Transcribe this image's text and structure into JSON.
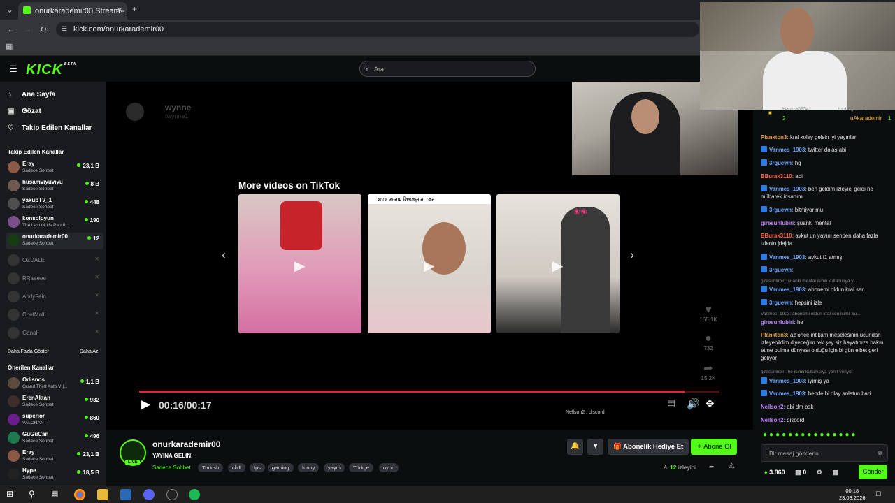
{
  "browser": {
    "tab_title": "onurkarademir00 Stream - ℹ",
    "url": "kick.com/onurkarademir00"
  },
  "header": {
    "logo": "KICK",
    "logo_badge": "BETA",
    "search_placeholder": "Ara"
  },
  "sidebar": {
    "nav": [
      {
        "label": "Ana Sayfa"
      },
      {
        "label": "Gözat"
      },
      {
        "label": "Takip Edilen Kanallar"
      }
    ],
    "followed_title": "Takip Edilen Kanallar",
    "followed": [
      {
        "name": "Eray",
        "category": "Sadece Sohbet",
        "viewers": "23,1 B"
      },
      {
        "name": "husamviyuviyu",
        "category": "Sadece Sohbet",
        "viewers": "8 B"
      },
      {
        "name": "yakupTV_1",
        "category": "Sadece Sohbet",
        "viewers": "448"
      },
      {
        "name": "konsoloyun",
        "category": "The Last of Us Part II: ...",
        "viewers": "190"
      },
      {
        "name": "onurkarademir00",
        "category": "Sadece Sohbet",
        "viewers": "12"
      },
      {
        "name": "OZDALE",
        "category": "",
        "viewers": ""
      },
      {
        "name": "RRaeeee",
        "category": "",
        "viewers": ""
      },
      {
        "name": "AndyFein",
        "category": "",
        "viewers": ""
      },
      {
        "name": "ChefMalli",
        "category": "",
        "viewers": ""
      },
      {
        "name": "Ganali",
        "category": "",
        "viewers": ""
      }
    ],
    "show_more": "Daha Fazla Göster",
    "show_less": "Daha Az",
    "recommended_title": "Önerilen Kanallar",
    "recommended": [
      {
        "name": "Odisnos",
        "category": "Grand Theft Auto V |...",
        "viewers": "1,1 B"
      },
      {
        "name": "ErenAktan",
        "category": "Sadece Sohbet",
        "viewers": "932"
      },
      {
        "name": "superior",
        "category": "VALORANT",
        "viewers": "860"
      },
      {
        "name": "GuGuCan",
        "category": "Sadece Sohbet",
        "viewers": "496"
      },
      {
        "name": "Eray",
        "category": "Sadece Sohbet",
        "viewers": "23,1 B"
      },
      {
        "name": "Hype",
        "category": "Sadece Sohbet",
        "viewers": "18,5 B"
      }
    ]
  },
  "video": {
    "watermark_name": "wynne",
    "watermark_handle": "twynne1",
    "tiktok_title": "More videos on TikTok",
    "thumb1_caption": "",
    "thumb2_caption": "লাগে ক্র নাম লিখছেন না কেন",
    "likes": "165.1K",
    "comments": "732",
    "shares": "15.2K",
    "time": "00:16/00:17",
    "progress": 0.94,
    "discord_text": "Nellson2 : discord"
  },
  "info": {
    "channel": "onurkarademir00",
    "live": "LIVE",
    "title": "YAYINA GELİN!",
    "category": "Sadece Sohbet",
    "tags": [
      "Turkish",
      "chill",
      "fps",
      "gaming",
      "funny",
      "yayın",
      "Türkçe",
      "oyun"
    ],
    "gift_label": "Abonelik Hediye Et",
    "subscribe_label": "Abone Ol",
    "viewers": "12",
    "viewers_label": "izleyici"
  },
  "chat": {
    "leader1_name": "Hamza5854",
    "leader1_count": "2",
    "leader2_name": "tuntr3gronor",
    "leader3_name": "uAkarademir",
    "leader3_count": "1",
    "messages": [
      {
        "user": "Plankton3",
        "color": "#e8a23a",
        "badge": false,
        "text": "kral kolay gelsin iyi yayınlar"
      },
      {
        "user": "Vanmes_1903",
        "color": "#6fa8ff",
        "badge": true,
        "text": "twitter dolaş abi"
      },
      {
        "user": "3rguewn",
        "color": "#6fa8ff",
        "badge": true,
        "text": "hg"
      },
      {
        "user": "BBurak3110",
        "color": "#ff6a4a",
        "badge": false,
        "text": "abi"
      },
      {
        "user": "Vanmes_1903",
        "color": "#6fa8ff",
        "badge": true,
        "text": "ben geldim izleyici geldi ne mübarek insanım"
      },
      {
        "user": "3rguewn",
        "color": "#6fa8ff",
        "badge": true,
        "text": "bitmiyor mu"
      },
      {
        "user": "giresunlubiri",
        "color": "#c084fc",
        "badge": false,
        "text": "şuanki mental"
      },
      {
        "user": "BBurak3110",
        "color": "#ff6a4a",
        "badge": false,
        "text": "aykut un yayını senden daha fazla izlenio jdajda"
      },
      {
        "user": "Vanmes_1903",
        "color": "#6fa8ff",
        "badge": true,
        "text": "aykut f1 atmış"
      },
      {
        "user": "3rguewn",
        "color": "#6fa8ff",
        "badge": true,
        "text": ""
      },
      {
        "user": "Vanmes_1903",
        "color": "#6fa8ff",
        "badge": true,
        "text": "abonemi oldun kral sen"
      },
      {
        "user": "3rguewn",
        "color": "#6fa8ff",
        "badge": true,
        "text": "hepsini izle"
      },
      {
        "user": "giresunlubiri",
        "color": "#c084fc",
        "badge": false,
        "text": "he"
      },
      {
        "user": "Plankton3",
        "color": "#e8a23a",
        "badge": false,
        "text": "az önce intikam meselesinin ucundan izleyebildim diyeceğim tek şey siz hayatınıza bakın etme bulma dünyası olduğu için bi gün elbet geri geliyor"
      },
      {
        "user": "Vanmes_1903",
        "color": "#6fa8ff",
        "badge": true,
        "text": "iyimiş ya"
      },
      {
        "user": "Vanmes_1903",
        "color": "#6fa8ff",
        "badge": true,
        "text": "bende bi olay anlatım bari"
      },
      {
        "user": "Nellson2",
        "color": "#c084fc",
        "badge": false,
        "text": "abi dm bak"
      },
      {
        "user": "Nellson2",
        "color": "#c084fc",
        "badge": false,
        "text": "discord"
      }
    ],
    "reply1": "giresunlubiri: şuanki mental isimli kullanıcıya y...",
    "reply2": "Vanmes_1903: abonemi oldun kral sen isimli ku...",
    "reply3": "giresunlubiri: he isimli kullanıcıya yanıt veriyor",
    "input_placeholder": "Bir mesaj gönderin",
    "points": "3.860",
    "points2": "0",
    "send_label": "Gönder"
  },
  "taskbar": {
    "time": "00:18",
    "date": "23.03.2026"
  }
}
